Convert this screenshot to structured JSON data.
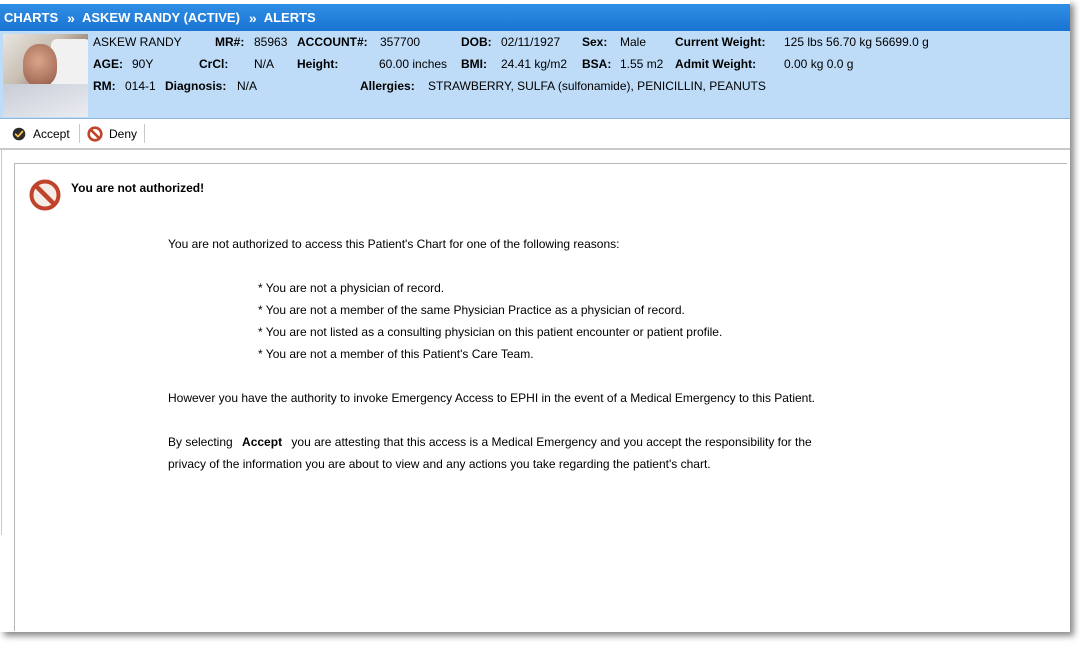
{
  "breadcrumb": {
    "items": [
      "CHARTS",
      "ASKEW RANDY (ACTIVE)",
      "ALERTS"
    ],
    "separator": "»"
  },
  "patient": {
    "name": "ASKEW RANDY",
    "mr_label": "MR#:",
    "mr": "85963",
    "account_label": "ACCOUNT#:",
    "account": "357700",
    "dob_label": "DOB:",
    "dob": "02/11/1927",
    "sex_label": "Sex:",
    "sex": "Male",
    "current_weight_label": "Current Weight:",
    "current_weight": "125 lbs 56.70 kg 56699.0 g",
    "age_label": "AGE:",
    "age": "90Y",
    "crcl_label": "CrCl:",
    "crcl": "N/A",
    "height_label": "Height:",
    "height": "60.00 inches",
    "bmi_label": "BMI:",
    "bmi": "24.41 kg/m2",
    "bsa_label": "BSA:",
    "bsa": "1.55 m2",
    "admit_weight_label": "Admit Weight:",
    "admit_weight": "0.00 kg 0.0 g",
    "rm_label": "RM:",
    "rm": "014-1",
    "diagnosis_label": "Diagnosis:",
    "diagnosis": "N/A",
    "allergies_label": "Allergies:",
    "allergies": "STRAWBERRY, SULFA (sulfonamide), PENICILLIN, PEANUTS"
  },
  "toolbar": {
    "accept_label": "Accept",
    "deny_label": "Deny"
  },
  "alert": {
    "title": "You are not authorized!",
    "intro": "You are not authorized to access this Patient's Chart for one of the following reasons:",
    "reasons": [
      "* You are not a physician of record.",
      "* You are not a member of the same Physician Practice as a physician of record.",
      "* You are not listed as a consulting physician on this patient encounter or patient profile.",
      "* You are not a member of this Patient's Care Team."
    ],
    "emergency": "However you have the authority to invoke Emergency Access to EPHI in the event of a Medical Emergency to this Patient.",
    "attest_prefix": "By selecting",
    "attest_keyword": "Accept",
    "attest_suffix": "you are attesting that this access is a Medical Emergency and you accept the responsibility for the",
    "attest_line2": "privacy of the information you are about to view and any actions you take regarding the patient's chart."
  },
  "colors": {
    "header_blue": "#1a74d2",
    "patient_bg": "#bedcf7",
    "deny_red": "#c0442a"
  }
}
